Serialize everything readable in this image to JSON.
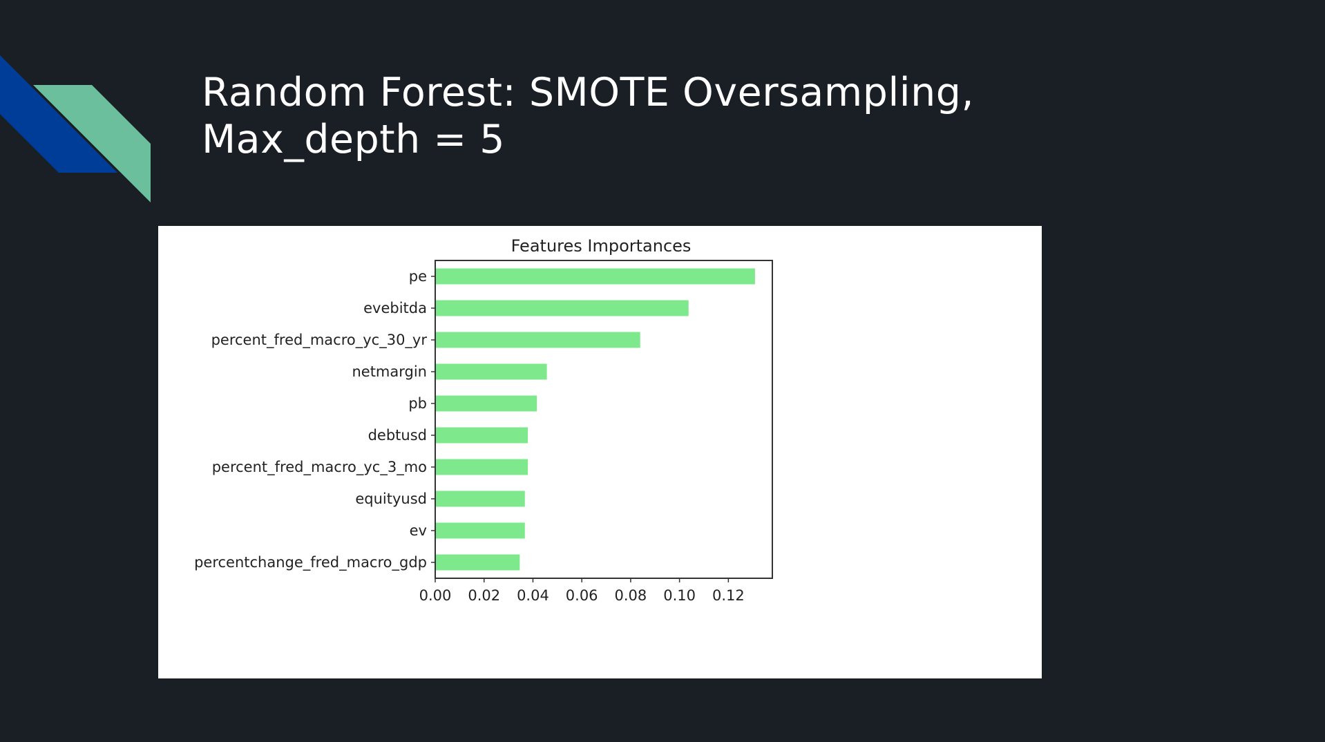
{
  "slide": {
    "title_line1": "Random Forest: SMOTE Oversampling,",
    "title_line2": "Max_depth = 5"
  },
  "colors": {
    "background": "#1a1f26",
    "accent_blue": "#003d99",
    "accent_green": "#6bbf9c",
    "bar": "#7de88c"
  },
  "chart_data": {
    "type": "bar",
    "orientation": "horizontal",
    "title": "Features Importances",
    "xlabel": "",
    "ylabel": "",
    "categories": [
      "pe",
      "evebitda",
      "percent_fred_macro_yc_30_yr",
      "netmargin",
      "pb",
      "debtusd",
      "percent_fred_macro_yc_3_mo",
      "equityusd",
      "ev",
      "percentchange_fred_macro_gdp"
    ],
    "values": [
      0.1309,
      0.1037,
      0.0839,
      0.0457,
      0.0416,
      0.0379,
      0.0379,
      0.0367,
      0.0367,
      0.0346
    ],
    "xlim": [
      0,
      0.138
    ],
    "xticks": [
      "0.00",
      "0.02",
      "0.04",
      "0.06",
      "0.08",
      "0.10",
      "0.12"
    ],
    "grid": false,
    "legend": "none"
  }
}
